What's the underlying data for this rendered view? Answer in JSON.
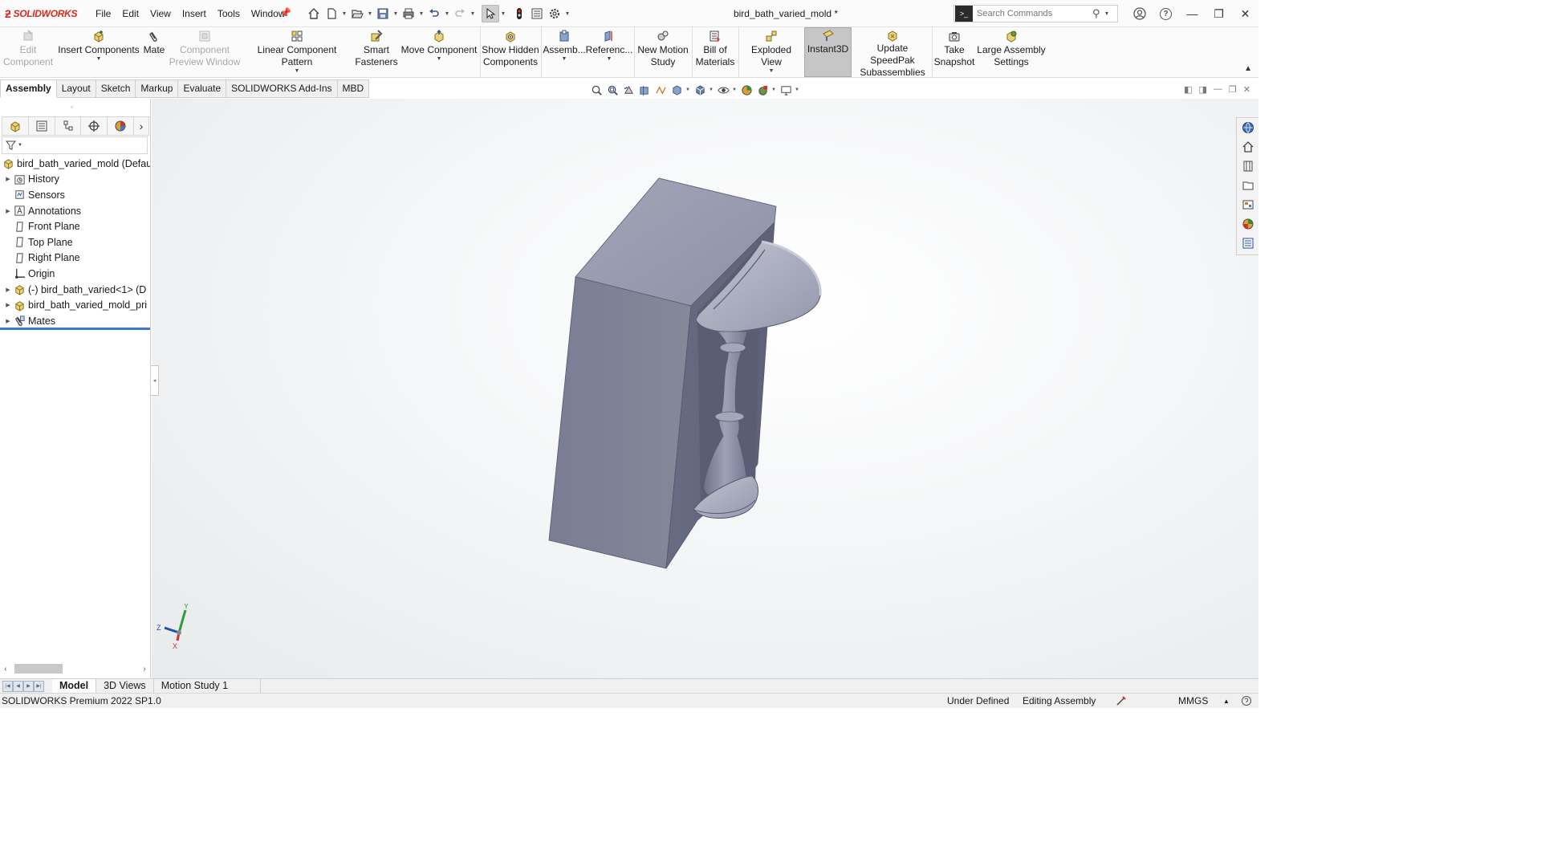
{
  "app": {
    "logo_text": "SOLIDWORKS",
    "document_title": "bird_bath_varied_mold *"
  },
  "menu": [
    "File",
    "Edit",
    "View",
    "Insert",
    "Tools",
    "Window"
  ],
  "search": {
    "placeholder": "Search Commands"
  },
  "ribbon": {
    "edit_component": [
      "Edit",
      "Component"
    ],
    "insert_components": "Insert Components",
    "mate": "Mate",
    "component_preview": [
      "Component",
      "Preview Window"
    ],
    "linear_pattern": "Linear Component Pattern",
    "smart_fasteners": [
      "Smart",
      "Fasteners"
    ],
    "move_component": "Move Component",
    "show_hidden": [
      "Show Hidden",
      "Components"
    ],
    "assembly_features": "Assemb...",
    "reference_geometry": "Referenc...",
    "new_motion_study": [
      "New Motion",
      "Study"
    ],
    "bill_of_materials": [
      "Bill of",
      "Materials"
    ],
    "exploded_view": "Exploded View",
    "instant3d": "Instant3D",
    "update_speedpak": [
      "Update SpeedPak",
      "Subassemblies"
    ],
    "take_snapshot": [
      "Take",
      "Snapshot"
    ],
    "large_assembly": [
      "Large Assembly",
      "Settings"
    ]
  },
  "command_tabs": [
    "Assembly",
    "Layout",
    "Sketch",
    "Markup",
    "Evaluate",
    "SOLIDWORKS Add-Ins",
    "MBD"
  ],
  "tree": {
    "root": "bird_bath_varied_mold  (Defau",
    "items": [
      {
        "label": "History",
        "expandable": true,
        "icon": "history-icon"
      },
      {
        "label": "Sensors",
        "expandable": false,
        "icon": "sensors-icon"
      },
      {
        "label": "Annotations",
        "expandable": true,
        "icon": "annotations-icon"
      },
      {
        "label": "Front Plane",
        "expandable": false,
        "icon": "plane-icon"
      },
      {
        "label": "Top Plane",
        "expandable": false,
        "icon": "plane-icon"
      },
      {
        "label": "Right Plane",
        "expandable": false,
        "icon": "plane-icon"
      },
      {
        "label": "Origin",
        "expandable": false,
        "icon": "origin-icon"
      },
      {
        "label": "(-) bird_bath_varied<1> (D",
        "expandable": true,
        "icon": "part-icon"
      },
      {
        "label": "bird_bath_varied_mold_pri",
        "expandable": true,
        "icon": "part-icon"
      },
      {
        "label": "Mates",
        "expandable": true,
        "icon": "mates-icon"
      }
    ]
  },
  "bottom_tabs": [
    "Model",
    "3D Views",
    "Motion Study 1"
  ],
  "status": {
    "product": "SOLIDWORKS Premium 2022 SP1.0",
    "definition": "Under Defined",
    "mode": "Editing Assembly",
    "units": "MMGS"
  },
  "triad": {
    "y": "Y",
    "z": "Z",
    "x": "X"
  },
  "colors": {
    "accent_red": "#d9291c",
    "model_front": "#7c7f97",
    "model_top": "#9a9db2",
    "model_side": "#6b6e84",
    "selection_blue": "#3a7cc8"
  }
}
